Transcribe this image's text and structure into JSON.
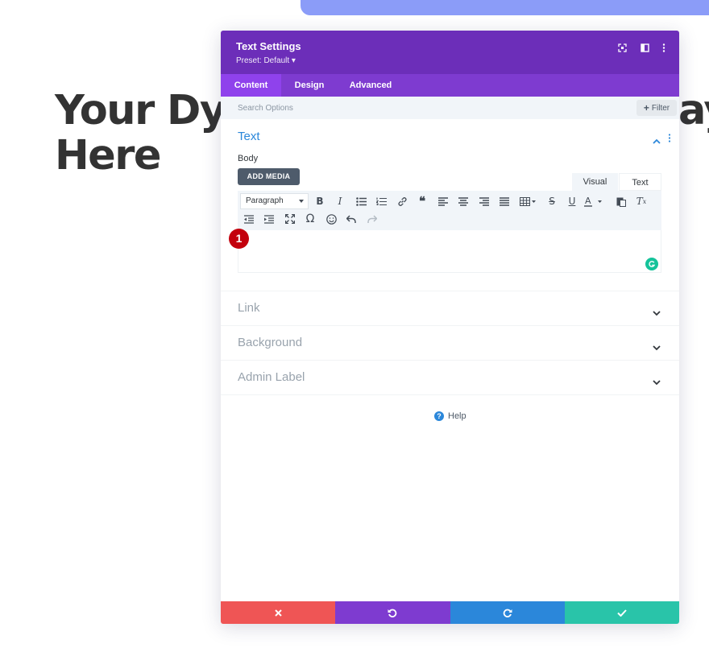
{
  "background": {
    "headline_line1_left": "Your Dyn",
    "headline_line1_right": "ay",
    "headline_line2": "Here"
  },
  "modal": {
    "title": "Text Settings",
    "preset": "Preset: Default ▾",
    "tabs": [
      {
        "label": "Content",
        "active": true
      },
      {
        "label": "Design",
        "active": false
      },
      {
        "label": "Advanced",
        "active": false
      }
    ],
    "search": {
      "placeholder": "Search Options"
    },
    "filter_label": "Filter",
    "text_section": {
      "title": "Text",
      "body_label": "Body",
      "add_media_label": "ADD MEDIA",
      "editor_tabs": {
        "visual": "Visual",
        "text": "Text"
      },
      "format_select_value": "Paragraph",
      "marker_number": "1"
    },
    "collapsed_sections": [
      "Link",
      "Background",
      "Admin Label"
    ],
    "help_label": "Help"
  },
  "colors": {
    "header": "#6c2eb9",
    "tabs": "#7e3bd0",
    "accent": "#2b87da",
    "discard": "#ef5555",
    "undo": "#7e3bd0",
    "redo": "#2b87da",
    "save": "#29c4a9"
  }
}
